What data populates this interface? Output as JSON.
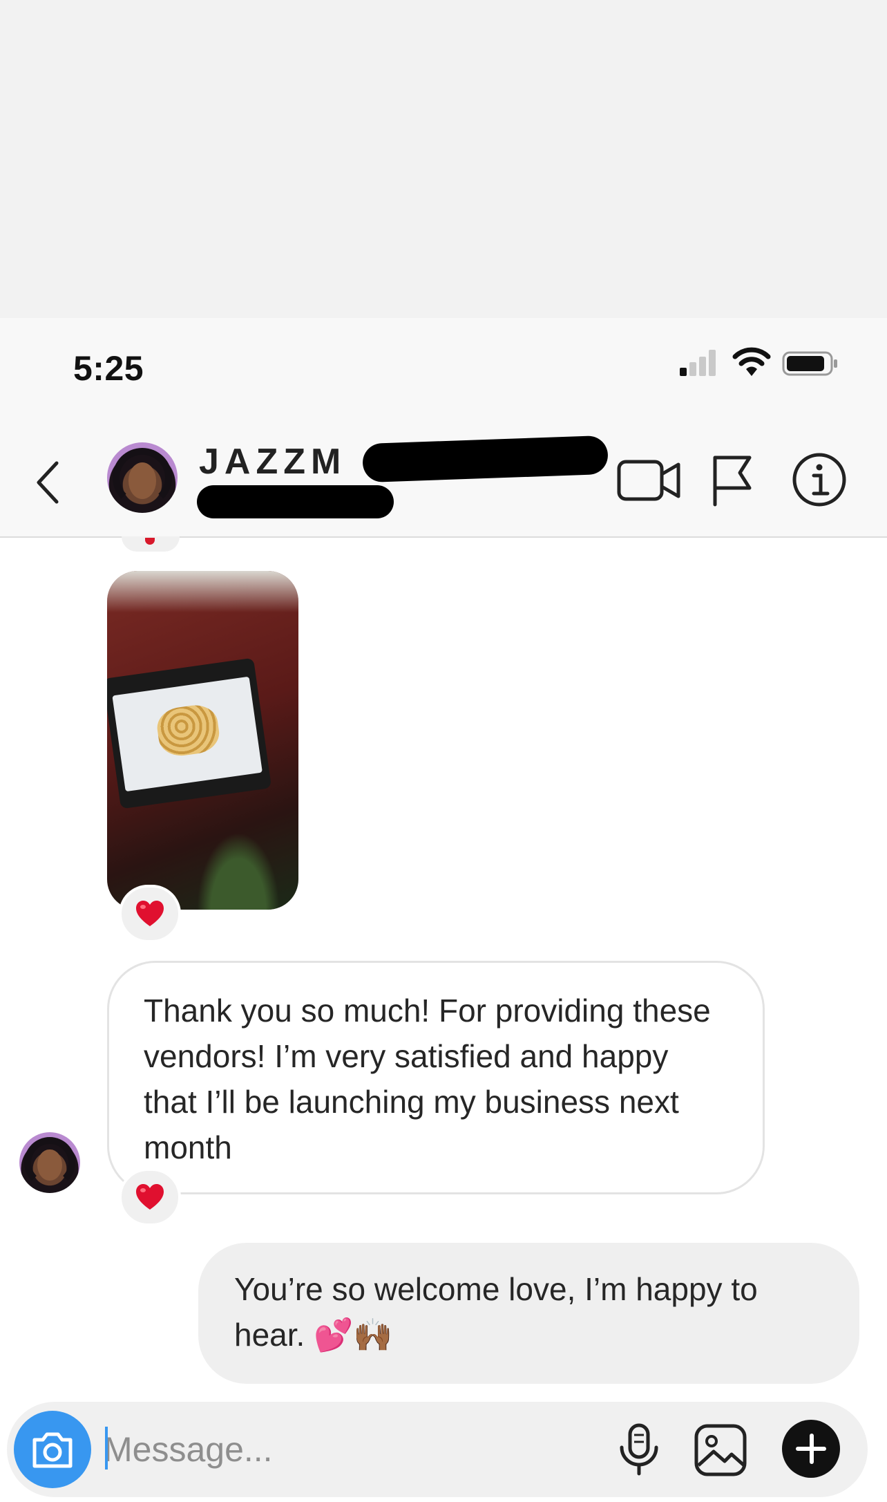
{
  "status_bar": {
    "time": "5:25"
  },
  "header": {
    "username": "JAZZM"
  },
  "messages": {
    "incoming_text": "Thank you so much! For providing these vendors! I’m very satisfied and happy that I’ll be launching my business next month",
    "outgoing_text": "You’re so welcome love, I’m happy to hear. 💕🙌🏾",
    "reaction_emoji": "heart"
  },
  "composer": {
    "placeholder": "Message..."
  },
  "colors": {
    "accent": "#3897f0",
    "heart": "#e0102f",
    "bubble_outgoing": "#efefef",
    "bubble_border": "#e3e3e3"
  }
}
